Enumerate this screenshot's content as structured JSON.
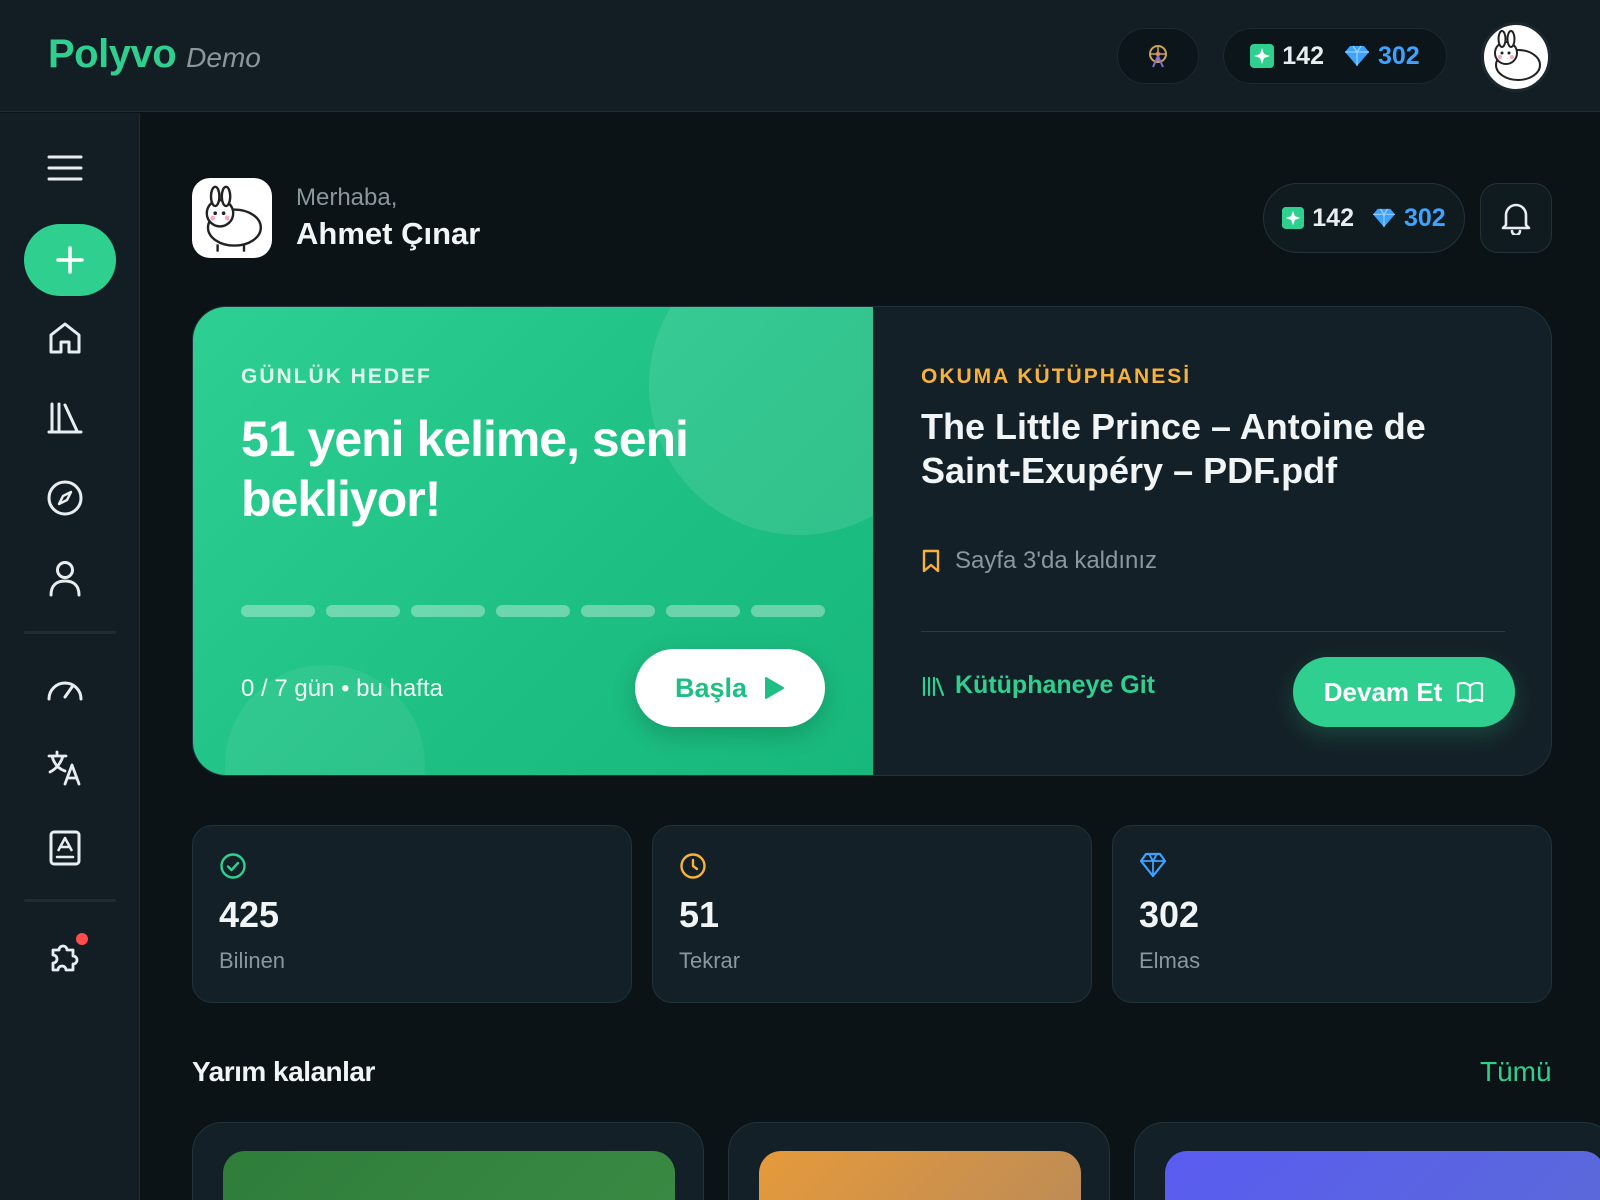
{
  "app": {
    "name": "Polyvo",
    "tag": "Demo"
  },
  "top_stats": {
    "sparks": "142",
    "gems": "302"
  },
  "greeting": {
    "hello": "Merhaba,",
    "name": "Ahmet Çınar"
  },
  "main_stats": {
    "sparks": "142",
    "gems": "302"
  },
  "daily_goal": {
    "eyebrow": "GÜNLÜK HEDEF",
    "title": "51 yeni kelime, seni bekliyor!",
    "progress_text": "0 / 7 gün • bu hafta",
    "days_done": 0,
    "days_total": 7,
    "start_label": "Başla"
  },
  "library": {
    "eyebrow": "OKUMA KÜTÜPHANESİ",
    "title": "The Little Prince – Antoine de Saint-Exupéry – PDF.pdf",
    "page_note": "Sayfa 3'da kaldınız",
    "link_label": "Kütüphaneye Git",
    "continue_label": "Devam Et"
  },
  "stats": [
    {
      "value": "425",
      "label": "Bilinen",
      "icon": "check-circle-icon",
      "color": "#2fd08f"
    },
    {
      "value": "51",
      "label": "Tekrar",
      "icon": "clock-icon",
      "color": "#f6b23a"
    },
    {
      "value": "302",
      "label": "Elmas",
      "icon": "gem-icon",
      "color": "#3ea3ff"
    }
  ],
  "section": {
    "title": "Yarım kalanlar",
    "link": "Tümü"
  },
  "colors": {
    "accent": "#2fd08f",
    "gold": "#f6b23a",
    "blue": "#3ea3ff",
    "background": "#0b1317"
  },
  "sidebar": {
    "icons": [
      "menu-icon",
      "add-icon",
      "home-icon",
      "library-icon",
      "compass-icon",
      "profile-icon",
      "speedometer-icon",
      "translate-icon",
      "contacts-book-icon",
      "puzzle-icon"
    ]
  }
}
